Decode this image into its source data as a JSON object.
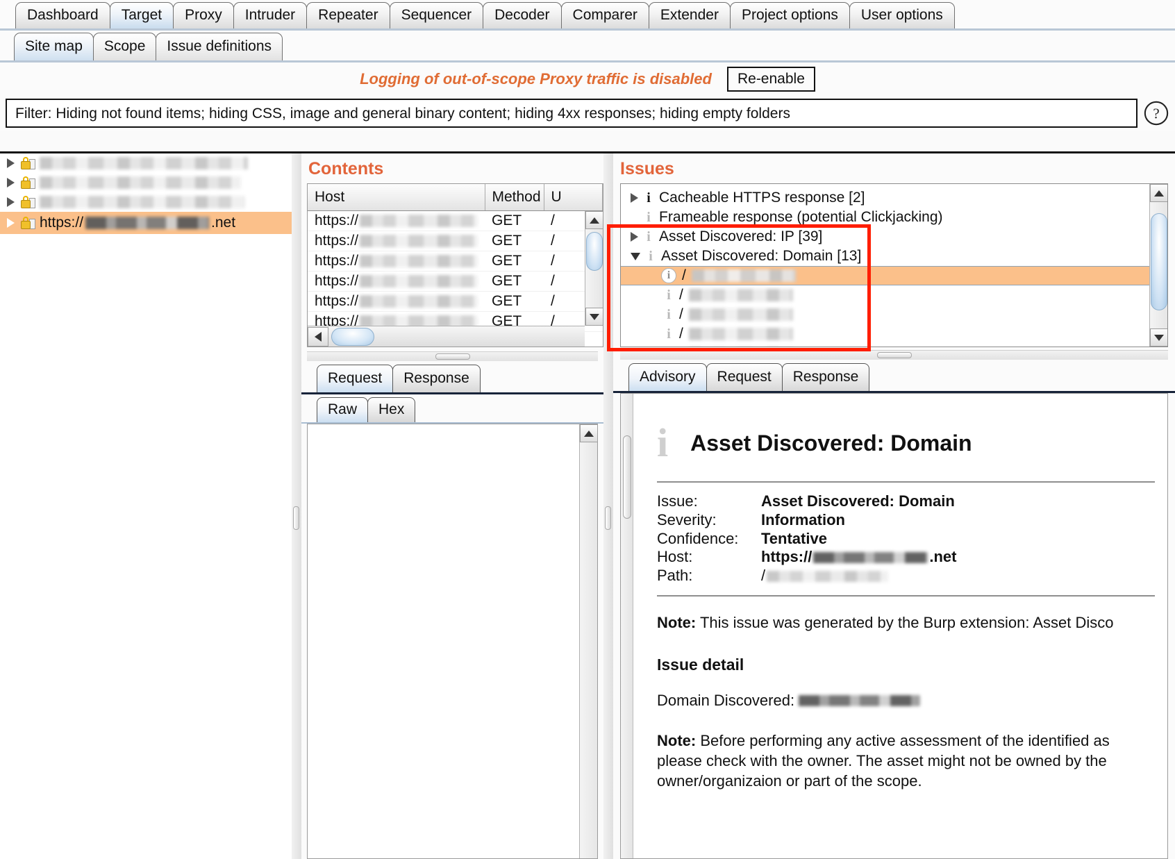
{
  "top_tabs": [
    {
      "label": "Dashboard",
      "selected": false
    },
    {
      "label": "Target",
      "selected": true
    },
    {
      "label": "Proxy",
      "selected": false
    },
    {
      "label": "Intruder",
      "selected": false
    },
    {
      "label": "Repeater",
      "selected": false
    },
    {
      "label": "Sequencer",
      "selected": false
    },
    {
      "label": "Decoder",
      "selected": false
    },
    {
      "label": "Comparer",
      "selected": false
    },
    {
      "label": "Extender",
      "selected": false
    },
    {
      "label": "Project options",
      "selected": false
    },
    {
      "label": "User options",
      "selected": false
    }
  ],
  "sub_tabs": [
    {
      "label": "Site map",
      "selected": true
    },
    {
      "label": "Scope",
      "selected": false
    },
    {
      "label": "Issue definitions",
      "selected": false
    }
  ],
  "notice": {
    "text": "Logging of out-of-scope Proxy traffic is disabled",
    "button_label": "Re-enable",
    "color": "#e06c34"
  },
  "filter": {
    "text": "Filter: Hiding not found items;  hiding CSS, image and general binary content;  hiding 4xx responses;  hiding empty folders",
    "help_icon": "question-mark-circle-icon"
  },
  "sitemap": {
    "rows": [
      {
        "label": "",
        "redacted": true,
        "selected": false,
        "expandable": true
      },
      {
        "label": "",
        "redacted": true,
        "selected": false,
        "expandable": true
      },
      {
        "label": "",
        "redacted": true,
        "selected": false,
        "expandable": true
      },
      {
        "label_prefix": "https://",
        "label_suffix": ".net",
        "redacted": true,
        "selected": true,
        "expandable": true
      }
    ]
  },
  "contents": {
    "title": "Contents",
    "columns": [
      "Host",
      "Method",
      "U"
    ],
    "rows": [
      {
        "host_prefix": "https://",
        "method": "GET",
        "url": "/"
      },
      {
        "host_prefix": "https://",
        "method": "GET",
        "url": "/"
      },
      {
        "host_prefix": "https://",
        "method": "GET",
        "url": "/"
      },
      {
        "host_prefix": "https://",
        "method": "GET",
        "url": "/"
      },
      {
        "host_prefix": "https://",
        "method": "GET",
        "url": "/"
      },
      {
        "host_prefix": "https://",
        "method": "GET",
        "url": "/"
      }
    ]
  },
  "message_tabs": [
    {
      "label": "Request",
      "selected": true
    },
    {
      "label": "Response",
      "selected": false
    }
  ],
  "view_tabs": [
    {
      "label": "Raw",
      "selected": true
    },
    {
      "label": "Hex",
      "selected": false
    }
  ],
  "issues": {
    "title": "Issues",
    "rows": [
      {
        "label": "Cacheable HTTPS response [2]",
        "caret": "right",
        "icon": "info-icon",
        "selected": false,
        "indent": 0
      },
      {
        "label": "Frameable response (potential Clickjacking)",
        "caret": "none",
        "icon": "info-icon",
        "selected": false,
        "indent": 0
      },
      {
        "label": "Asset Discovered: IP [39]",
        "caret": "right",
        "icon": "info-icon-muted",
        "selected": false,
        "indent": 0
      },
      {
        "label": "Asset Discovered: Domain [13]",
        "caret": "down",
        "icon": "info-icon-muted",
        "selected": false,
        "indent": 0
      },
      {
        "label": "/",
        "caret": "none",
        "icon": "info-badge-icon",
        "selected": true,
        "indent": 1,
        "redacted": true
      },
      {
        "label": "/",
        "caret": "none",
        "icon": "info-icon-muted",
        "selected": false,
        "indent": 1,
        "redacted": true
      },
      {
        "label": "/",
        "caret": "none",
        "icon": "info-icon-muted",
        "selected": false,
        "indent": 1,
        "redacted": true
      },
      {
        "label": "/",
        "caret": "none",
        "icon": "info-icon-muted",
        "selected": false,
        "indent": 1,
        "redacted": true
      },
      {
        "label": "/",
        "caret": "none",
        "icon": "info-icon-muted",
        "selected": false,
        "indent": 1,
        "redacted": true
      }
    ],
    "highlight_color": "#ff1d00"
  },
  "detail_tabs": [
    {
      "label": "Advisory",
      "selected": true
    },
    {
      "label": "Request",
      "selected": false
    },
    {
      "label": "Response",
      "selected": false
    }
  ],
  "advisory": {
    "icon": "info-icon",
    "title": "Asset Discovered: Domain",
    "fields": [
      {
        "key": "Issue:",
        "value": "Asset Discovered: Domain",
        "redacted": false
      },
      {
        "key": "Severity:",
        "value": "Information",
        "redacted": false
      },
      {
        "key": "Confidence:",
        "value": "Tentative",
        "redacted": false
      },
      {
        "key": "Host:",
        "value_prefix": "https://",
        "value_suffix": ".net",
        "redacted": true
      },
      {
        "key": "Path:",
        "value_prefix": "/",
        "value_suffix": "",
        "redacted": true
      }
    ],
    "note_label": "Note:",
    "note_text": "This issue was generated by the Burp extension: Asset Disco",
    "detail_heading": "Issue detail",
    "detail_label": "Domain Discovered:",
    "note2_label": "Note:",
    "note2_text": "Before performing any active assessment of the identified as please check with the owner. The asset might not be owned by the owner/organizaion or part of the scope."
  }
}
